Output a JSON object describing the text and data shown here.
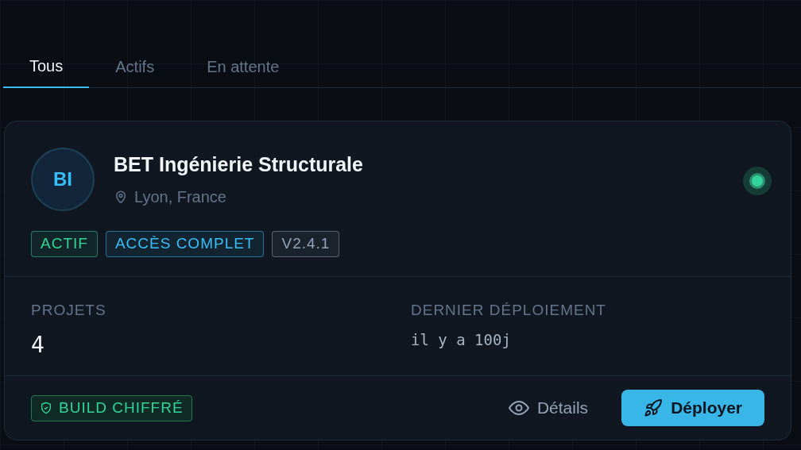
{
  "tabs": [
    {
      "label": "Tous",
      "selected": true
    },
    {
      "label": "Actifs",
      "selected": false
    },
    {
      "label": "En attente",
      "selected": false
    }
  ],
  "card": {
    "initials": "BI",
    "name": "BET Ingénierie Structurale",
    "location": "Lyon, France",
    "online": true,
    "badges": [
      {
        "label": "ACTIF",
        "color": "#34d399"
      },
      {
        "label": "ACCÈS COMPLET",
        "color": "#38bdf8"
      },
      {
        "label": "V2.4.1",
        "color": "#94a3b8"
      }
    ],
    "stats": [
      {
        "label": "PROJETS",
        "value": "4",
        "kind": "number"
      },
      {
        "label": "DERNIER DÉPLOIEMENT",
        "value": "il y a 100j",
        "kind": "mono"
      }
    ],
    "security_badge": "BUILD CHIFFRÉ",
    "details_button": "Détails",
    "deploy_button": "Déployer"
  }
}
